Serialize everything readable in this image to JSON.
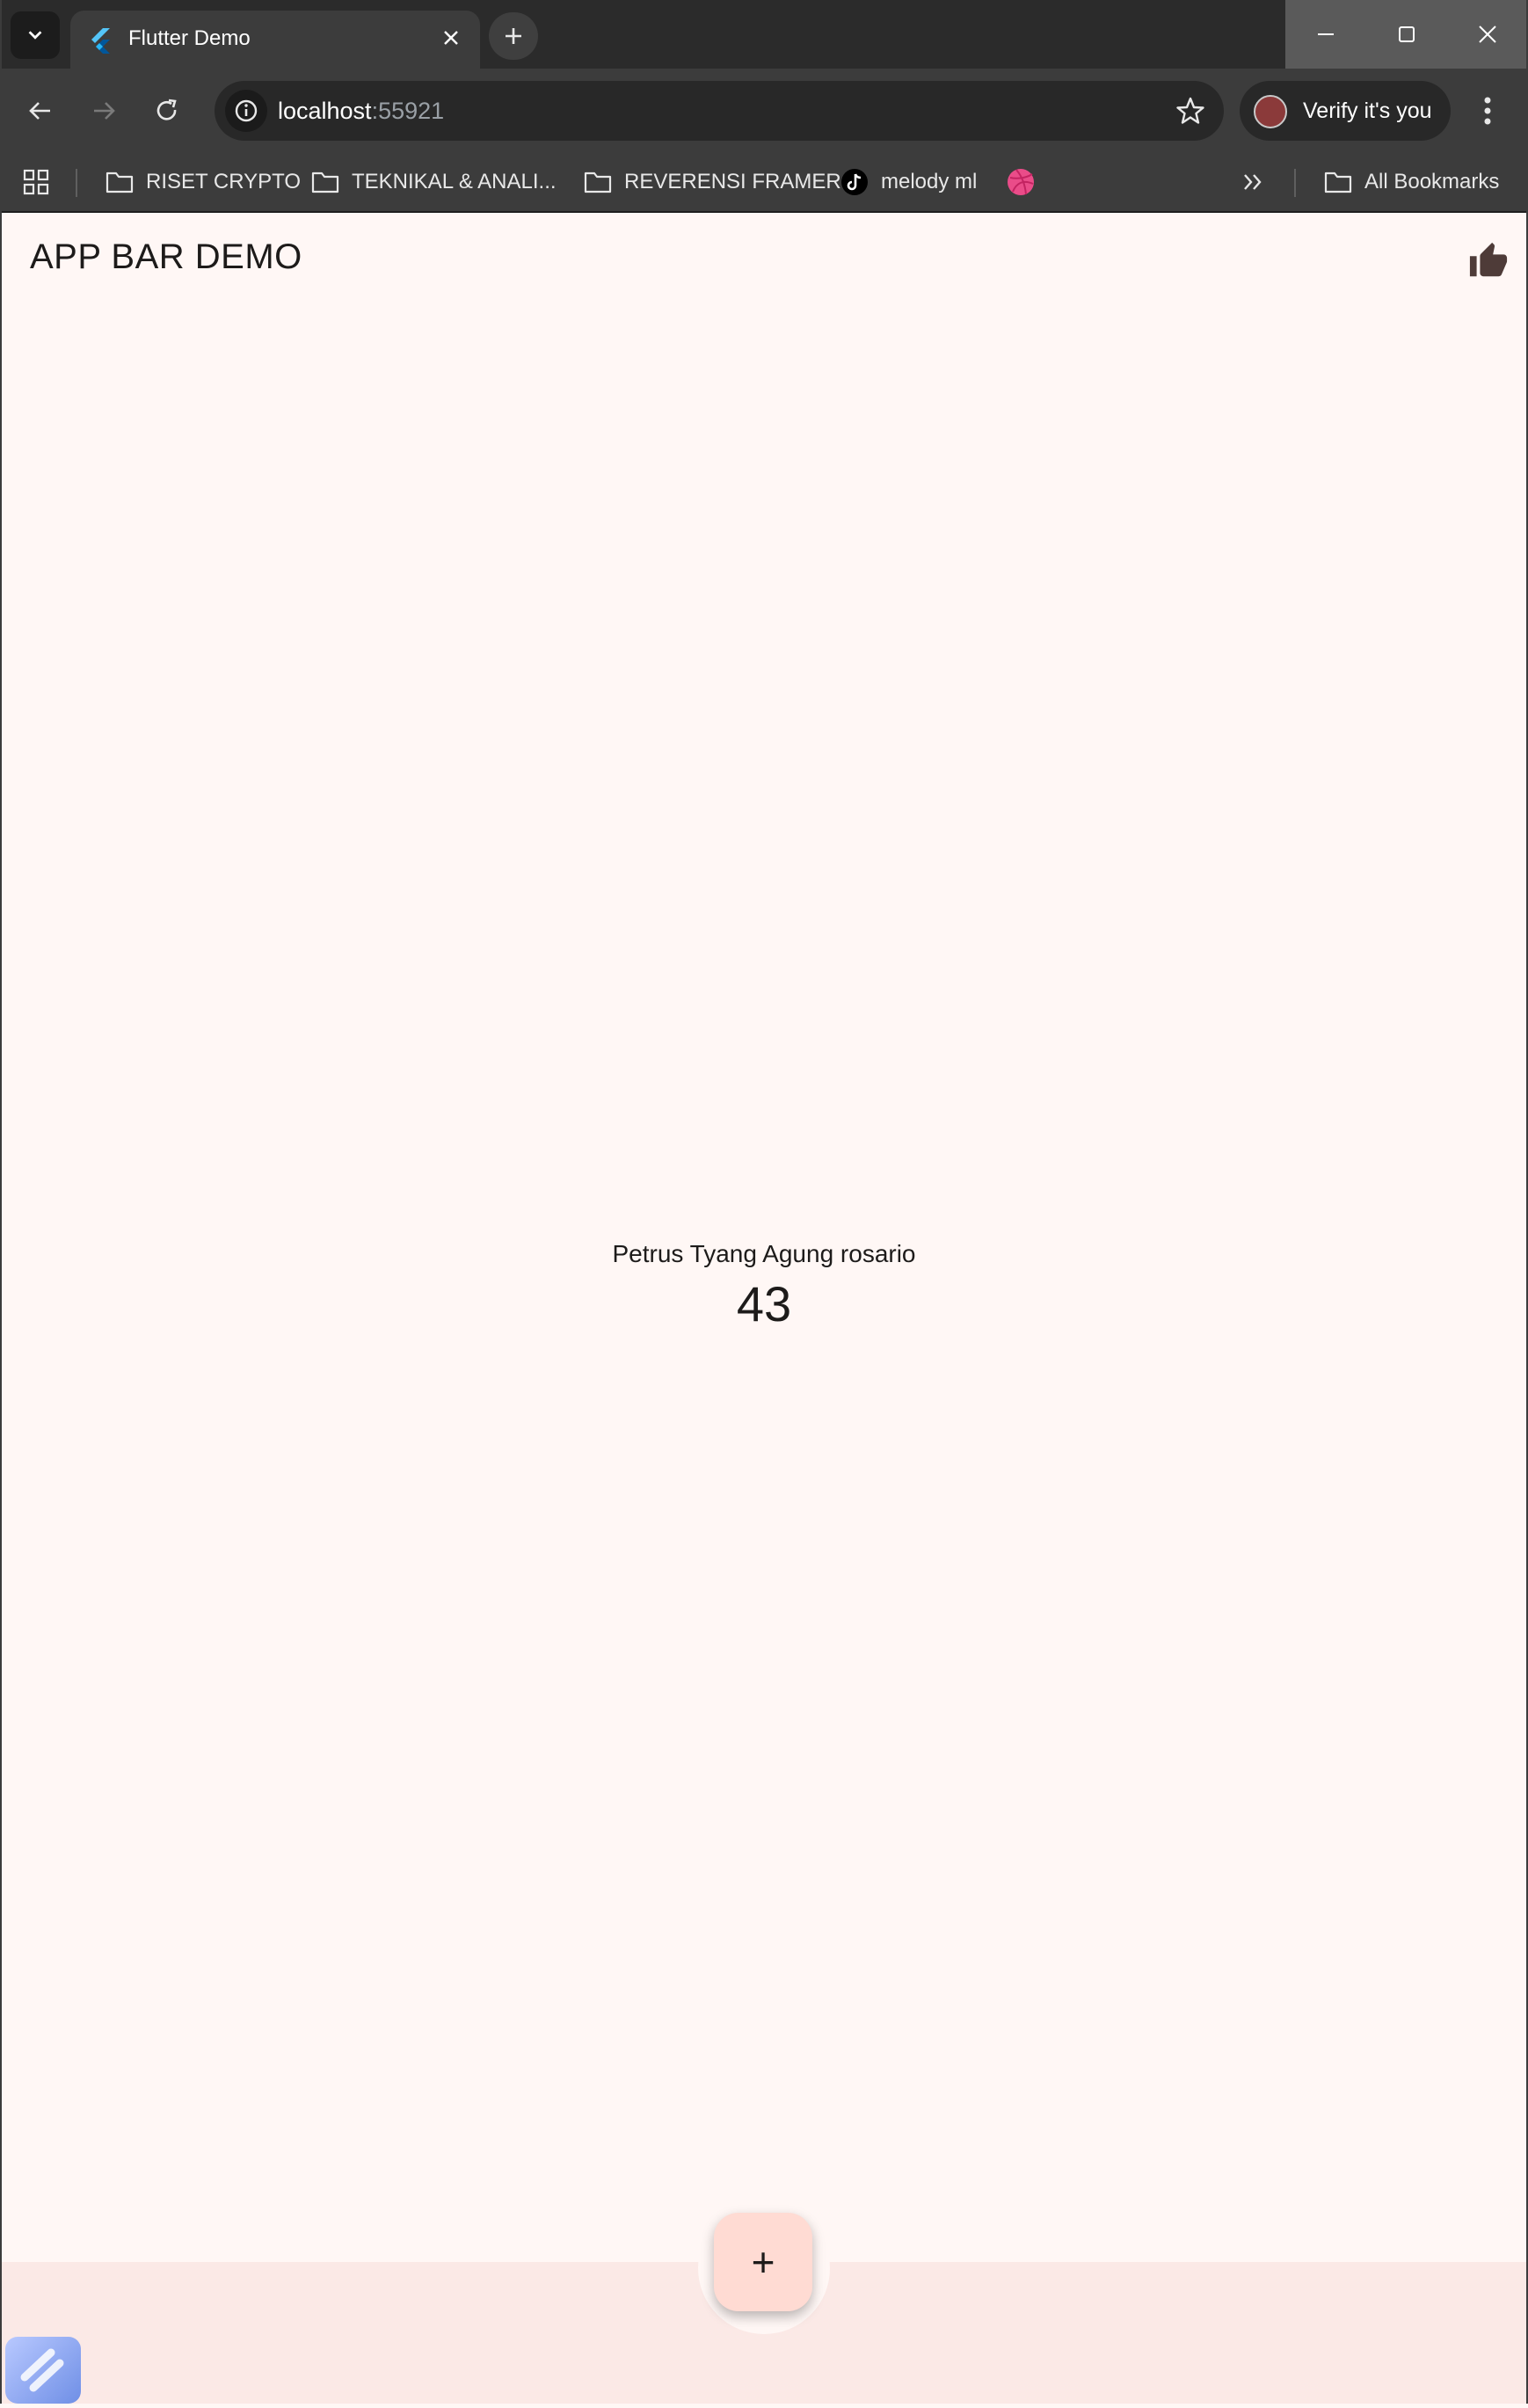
{
  "browser": {
    "tab": {
      "title": "Flutter Demo",
      "favicon": "flutter-logo-icon"
    },
    "address": {
      "host": "localhost",
      "port": ":55921"
    },
    "profile": {
      "label": "Verify it's you"
    },
    "bookmarks": [
      {
        "label": "RISET CRYPTO",
        "icon": "folder-icon"
      },
      {
        "label": "TEKNIKAL & ANALI...",
        "icon": "folder-icon"
      },
      {
        "label": "REVERENSI FRAMER",
        "icon": "folder-icon"
      },
      {
        "label": "melody ml",
        "icon": "tiktok-icon"
      },
      {
        "label": "",
        "icon": "dribbble-icon"
      }
    ],
    "all_bookmarks_label": "All Bookmarks"
  },
  "app": {
    "title": "APP BAR DEMO",
    "action_icon": "thumb-up-icon",
    "name_text": "Petrus Tyang Agung rosario",
    "counter": "43",
    "fab_label": "+",
    "colors": {
      "background": "#fff7f5",
      "bottom_bar": "#fbe9e6",
      "fab": "#ffdbd3"
    }
  }
}
